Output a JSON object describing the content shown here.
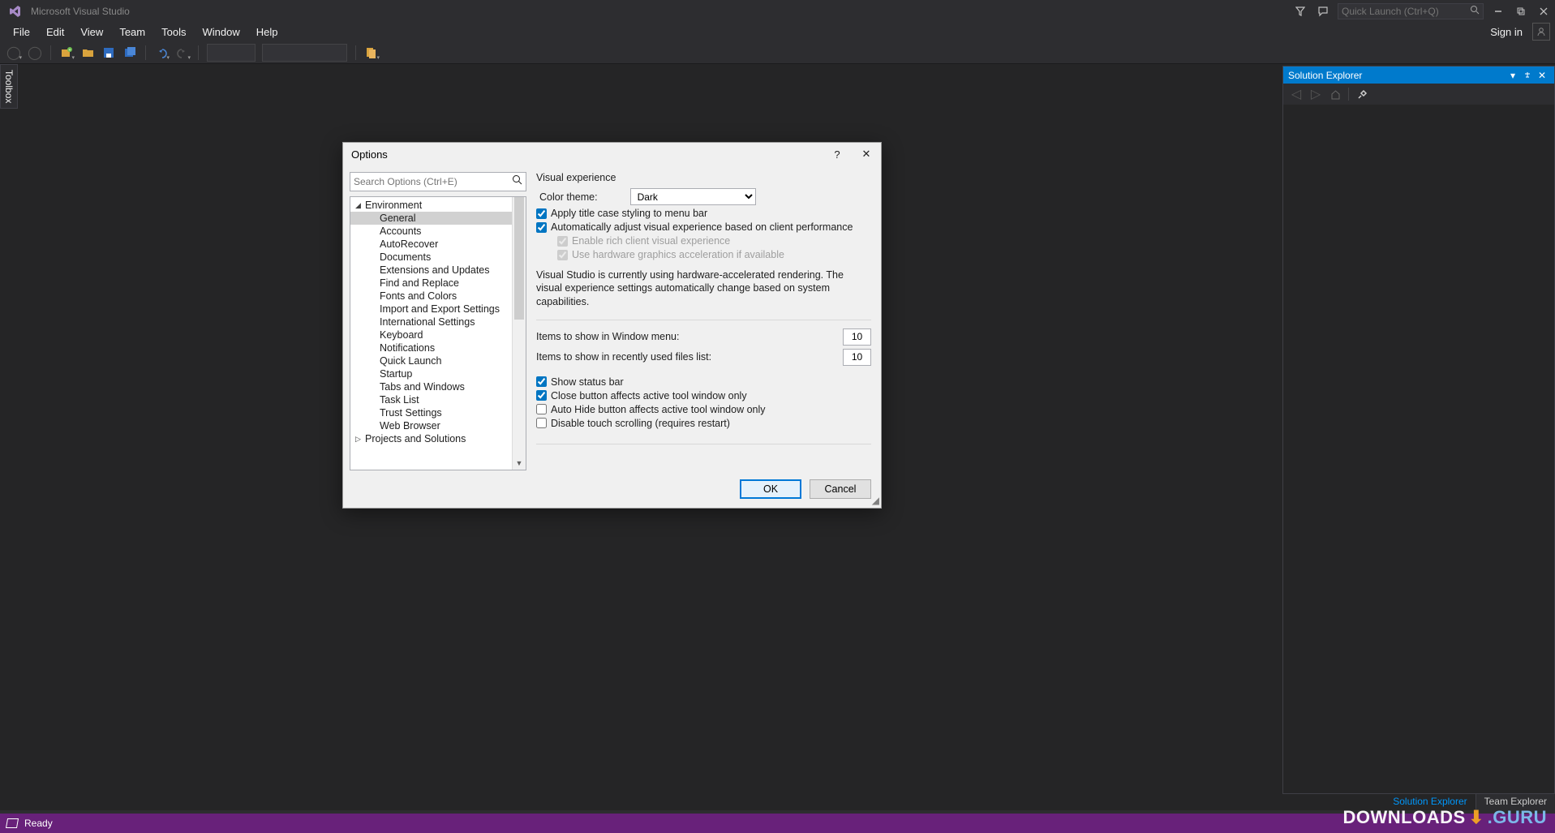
{
  "titlebar": {
    "app_name": "Microsoft Visual Studio",
    "quick_launch_placeholder": "Quick Launch (Ctrl+Q)"
  },
  "menu": {
    "items": [
      "File",
      "Edit",
      "View",
      "Team",
      "Tools",
      "Window",
      "Help"
    ],
    "signin": "Sign in"
  },
  "sidetab": {
    "toolbox": "Toolbox"
  },
  "solution_explorer": {
    "title": "Solution Explorer"
  },
  "bottom_tabs": {
    "active": "Solution Explorer",
    "inactive": "Team Explorer"
  },
  "statusbar": {
    "ready": "Ready"
  },
  "dialog": {
    "title": "Options",
    "search_placeholder": "Search Options (Ctrl+E)",
    "tree": {
      "environment": "Environment",
      "items": [
        "General",
        "Accounts",
        "AutoRecover",
        "Documents",
        "Extensions and Updates",
        "Find and Replace",
        "Fonts and Colors",
        "Import and Export Settings",
        "International Settings",
        "Keyboard",
        "Notifications",
        "Quick Launch",
        "Startup",
        "Tabs and Windows",
        "Task List",
        "Trust Settings",
        "Web Browser"
      ],
      "projects": "Projects and Solutions"
    },
    "main": {
      "section": "Visual experience",
      "color_theme_label": "Color theme:",
      "color_theme_value": "Dark",
      "cb_titlecase": "Apply title case styling to menu bar",
      "cb_autoadjust": "Automatically adjust visual experience based on client performance",
      "cb_rich": "Enable rich client visual experience",
      "cb_hw": "Use hardware graphics acceleration if available",
      "desc": "Visual Studio is currently using hardware-accelerated rendering. The visual experience settings automatically change based on system capabilities.",
      "items_window_label": "Items to show in Window menu:",
      "items_window_value": "10",
      "items_recent_label": "Items to show in recently used files list:",
      "items_recent_value": "10",
      "cb_status": "Show status bar",
      "cb_close_affects": "Close button affects active tool window only",
      "cb_autohide_affects": "Auto Hide button affects active tool window only",
      "cb_touch": "Disable touch scrolling (requires restart)"
    },
    "footer": {
      "ok": "OK",
      "cancel": "Cancel"
    }
  },
  "watermark": {
    "a": "DOWNLOADS",
    "b": ".GURU"
  }
}
